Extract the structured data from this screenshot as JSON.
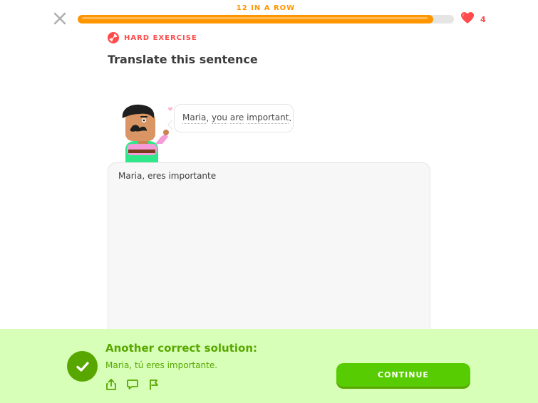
{
  "header": {
    "streak_label": "12 IN A ROW",
    "progress_fraction": 0.945,
    "hearts_count": "4",
    "colors": {
      "progress": "#ff9600",
      "heart": "#ff4b4b",
      "track": "#e5e5e5"
    }
  },
  "challenge": {
    "badge_icon": "dumbbell-icon",
    "badge_label": "HARD EXERCISE",
    "title": "Translate this sentence",
    "character": "oscar-character",
    "speech_words": [
      "Maria",
      ", ",
      "you",
      " ",
      "are",
      " ",
      "important",
      "."
    ],
    "answer_value": "Maria, eres importante"
  },
  "result": {
    "title": "Another correct solution:",
    "solution": "Maria, tú eres importante.",
    "continue_label": "CONTINUE",
    "icons": [
      "share-icon",
      "comment-icon",
      "report-flag-icon"
    ],
    "colors": {
      "panel": "#d7ffb8",
      "accent": "#58a700",
      "button": "#58cc02"
    }
  }
}
